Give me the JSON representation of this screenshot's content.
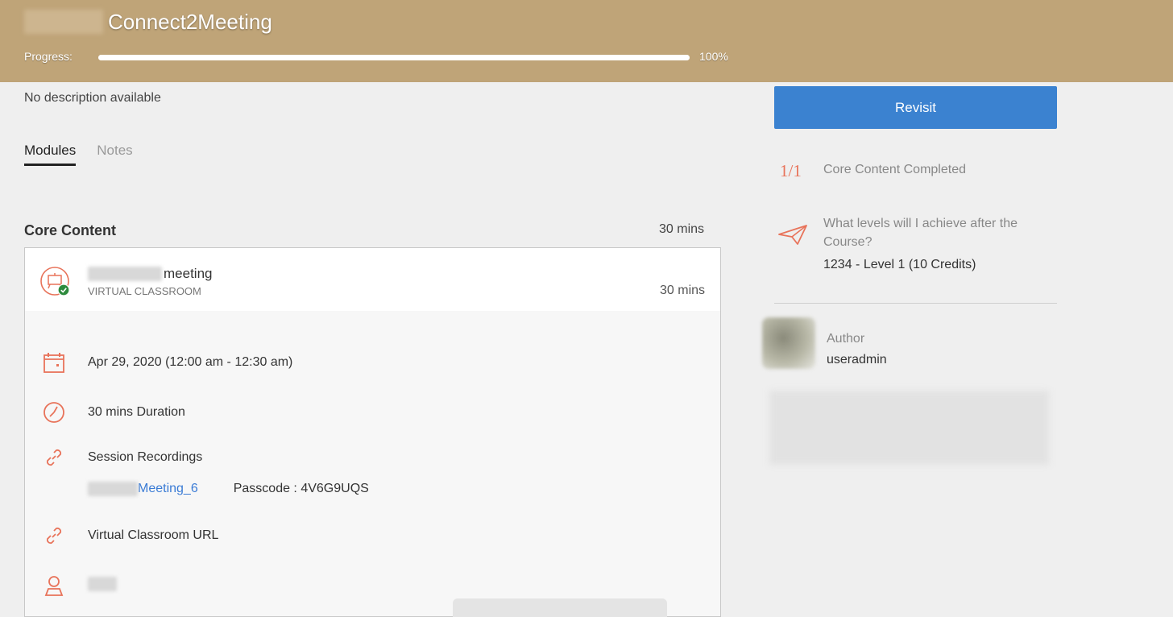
{
  "header": {
    "title": "Connect2Meeting",
    "progress_label": "Progress:",
    "progress_value": "100%",
    "progress_fraction": 1.0,
    "bg_color": "#bfa478"
  },
  "description": "No description available",
  "tabs": [
    {
      "label": "Modules",
      "active": true
    },
    {
      "label": "Notes",
      "active": false
    }
  ],
  "core_section": {
    "title": "Core Content",
    "duration": "30 mins"
  },
  "module": {
    "name": "meeting",
    "type": "VIRTUAL CLASSROOM",
    "duration": "30 mins",
    "icon": "virtual-classroom-icon",
    "status_icon": "check-circle-icon",
    "details": {
      "date": "Apr 29, 2020 (12:00 am - 12:30 am)",
      "duration": "30 mins Duration",
      "recordings_label": "Session Recordings",
      "recording_link": "Meeting_6",
      "passcode": "Passcode : 4V6G9UQS",
      "classroom_url": "Virtual Classroom URL"
    }
  },
  "sidebar": {
    "revisit_label": "Revisit",
    "core_count": "1/1",
    "core_label": "Core Content Completed",
    "levels_question": "What levels will I achieve after the Course?",
    "levels_answer": "1234 - Level 1 (10 Credits)",
    "author_label": "Author",
    "author_name": "useradmin"
  },
  "colors": {
    "accent": "#3b82d0",
    "icon": "#e8735a",
    "success": "#2e8b3d"
  }
}
